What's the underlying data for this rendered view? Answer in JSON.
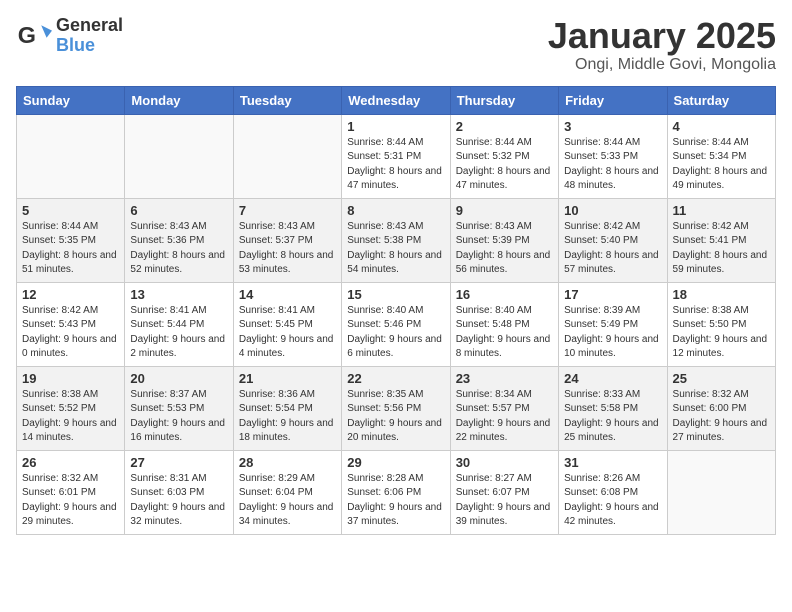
{
  "logo": {
    "general": "General",
    "blue": "Blue"
  },
  "title": "January 2025",
  "subtitle": "Ongi, Middle Govi, Mongolia",
  "weekdays": [
    "Sunday",
    "Monday",
    "Tuesday",
    "Wednesday",
    "Thursday",
    "Friday",
    "Saturday"
  ],
  "weeks": [
    [
      {
        "day": "",
        "info": ""
      },
      {
        "day": "",
        "info": ""
      },
      {
        "day": "",
        "info": ""
      },
      {
        "day": "1",
        "info": "Sunrise: 8:44 AM\nSunset: 5:31 PM\nDaylight: 8 hours and 47 minutes."
      },
      {
        "day": "2",
        "info": "Sunrise: 8:44 AM\nSunset: 5:32 PM\nDaylight: 8 hours and 47 minutes."
      },
      {
        "day": "3",
        "info": "Sunrise: 8:44 AM\nSunset: 5:33 PM\nDaylight: 8 hours and 48 minutes."
      },
      {
        "day": "4",
        "info": "Sunrise: 8:44 AM\nSunset: 5:34 PM\nDaylight: 8 hours and 49 minutes."
      }
    ],
    [
      {
        "day": "5",
        "info": "Sunrise: 8:44 AM\nSunset: 5:35 PM\nDaylight: 8 hours and 51 minutes."
      },
      {
        "day": "6",
        "info": "Sunrise: 8:43 AM\nSunset: 5:36 PM\nDaylight: 8 hours and 52 minutes."
      },
      {
        "day": "7",
        "info": "Sunrise: 8:43 AM\nSunset: 5:37 PM\nDaylight: 8 hours and 53 minutes."
      },
      {
        "day": "8",
        "info": "Sunrise: 8:43 AM\nSunset: 5:38 PM\nDaylight: 8 hours and 54 minutes."
      },
      {
        "day": "9",
        "info": "Sunrise: 8:43 AM\nSunset: 5:39 PM\nDaylight: 8 hours and 56 minutes."
      },
      {
        "day": "10",
        "info": "Sunrise: 8:42 AM\nSunset: 5:40 PM\nDaylight: 8 hours and 57 minutes."
      },
      {
        "day": "11",
        "info": "Sunrise: 8:42 AM\nSunset: 5:41 PM\nDaylight: 8 hours and 59 minutes."
      }
    ],
    [
      {
        "day": "12",
        "info": "Sunrise: 8:42 AM\nSunset: 5:43 PM\nDaylight: 9 hours and 0 minutes."
      },
      {
        "day": "13",
        "info": "Sunrise: 8:41 AM\nSunset: 5:44 PM\nDaylight: 9 hours and 2 minutes."
      },
      {
        "day": "14",
        "info": "Sunrise: 8:41 AM\nSunset: 5:45 PM\nDaylight: 9 hours and 4 minutes."
      },
      {
        "day": "15",
        "info": "Sunrise: 8:40 AM\nSunset: 5:46 PM\nDaylight: 9 hours and 6 minutes."
      },
      {
        "day": "16",
        "info": "Sunrise: 8:40 AM\nSunset: 5:48 PM\nDaylight: 9 hours and 8 minutes."
      },
      {
        "day": "17",
        "info": "Sunrise: 8:39 AM\nSunset: 5:49 PM\nDaylight: 9 hours and 10 minutes."
      },
      {
        "day": "18",
        "info": "Sunrise: 8:38 AM\nSunset: 5:50 PM\nDaylight: 9 hours and 12 minutes."
      }
    ],
    [
      {
        "day": "19",
        "info": "Sunrise: 8:38 AM\nSunset: 5:52 PM\nDaylight: 9 hours and 14 minutes."
      },
      {
        "day": "20",
        "info": "Sunrise: 8:37 AM\nSunset: 5:53 PM\nDaylight: 9 hours and 16 minutes."
      },
      {
        "day": "21",
        "info": "Sunrise: 8:36 AM\nSunset: 5:54 PM\nDaylight: 9 hours and 18 minutes."
      },
      {
        "day": "22",
        "info": "Sunrise: 8:35 AM\nSunset: 5:56 PM\nDaylight: 9 hours and 20 minutes."
      },
      {
        "day": "23",
        "info": "Sunrise: 8:34 AM\nSunset: 5:57 PM\nDaylight: 9 hours and 22 minutes."
      },
      {
        "day": "24",
        "info": "Sunrise: 8:33 AM\nSunset: 5:58 PM\nDaylight: 9 hours and 25 minutes."
      },
      {
        "day": "25",
        "info": "Sunrise: 8:32 AM\nSunset: 6:00 PM\nDaylight: 9 hours and 27 minutes."
      }
    ],
    [
      {
        "day": "26",
        "info": "Sunrise: 8:32 AM\nSunset: 6:01 PM\nDaylight: 9 hours and 29 minutes."
      },
      {
        "day": "27",
        "info": "Sunrise: 8:31 AM\nSunset: 6:03 PM\nDaylight: 9 hours and 32 minutes."
      },
      {
        "day": "28",
        "info": "Sunrise: 8:29 AM\nSunset: 6:04 PM\nDaylight: 9 hours and 34 minutes."
      },
      {
        "day": "29",
        "info": "Sunrise: 8:28 AM\nSunset: 6:06 PM\nDaylight: 9 hours and 37 minutes."
      },
      {
        "day": "30",
        "info": "Sunrise: 8:27 AM\nSunset: 6:07 PM\nDaylight: 9 hours and 39 minutes."
      },
      {
        "day": "31",
        "info": "Sunrise: 8:26 AM\nSunset: 6:08 PM\nDaylight: 9 hours and 42 minutes."
      },
      {
        "day": "",
        "info": ""
      }
    ]
  ]
}
